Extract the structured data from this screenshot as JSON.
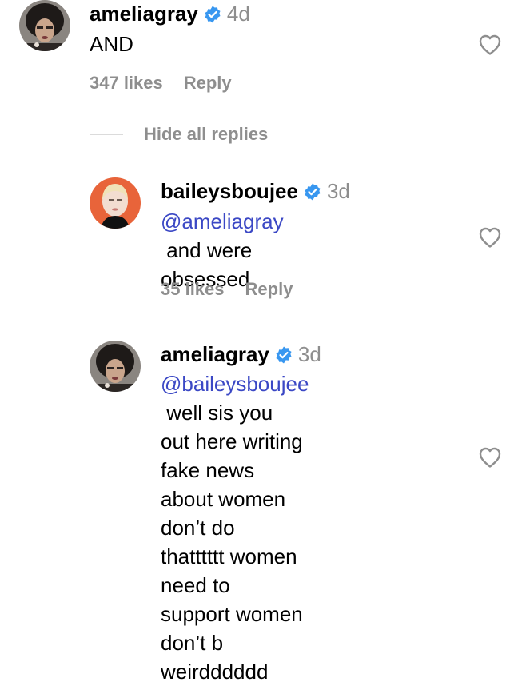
{
  "colors": {
    "text": "#000000",
    "muted": "#8e8e8e",
    "mention": "#3b48c5",
    "verified": "#3897f0",
    "divider": "#dbdbdb"
  },
  "comment": {
    "username": "ameliagray",
    "time": "4d",
    "text": "AND",
    "likes": "347 likes",
    "reply_label": "Reply",
    "verified_icon": "verified-badge-icon",
    "heart_icon": "heart-outline-icon"
  },
  "hide_replies_label": "Hide all replies",
  "replies": [
    {
      "username": "baileysboujee",
      "time": "3d",
      "mention": "@ameliagray",
      "text_line1_rest": " and were",
      "text_lines": [
        "obsessed"
      ],
      "likes": "35 likes",
      "reply_label": "Reply"
    },
    {
      "username": "ameliagray",
      "time": "3d",
      "mention": "@baileysboujee",
      "text_line1_rest": " well sis you",
      "text_lines": [
        "out here writing fake news",
        "about women don’t do",
        "thatttttt women need to",
        "support women don’t b",
        "weirdddddd"
      ]
    }
  ]
}
